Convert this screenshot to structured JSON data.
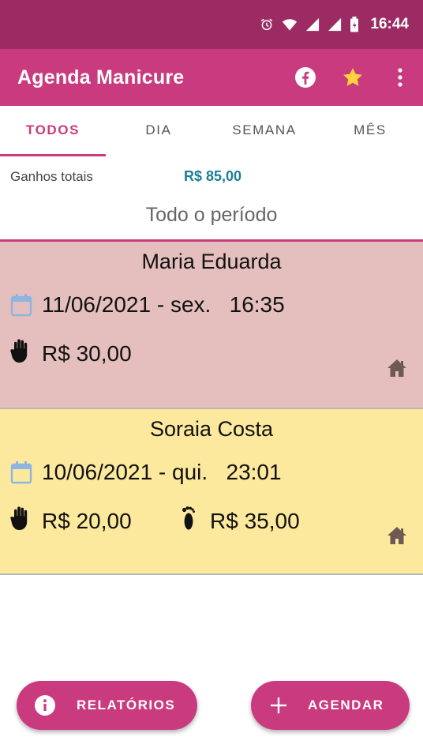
{
  "status_bar": {
    "time": "16:44"
  },
  "app_bar": {
    "title": "Agenda Manicure"
  },
  "tabs": [
    {
      "label": "TODOS",
      "active": true
    },
    {
      "label": "DIA",
      "active": false
    },
    {
      "label": "SEMANA",
      "active": false
    },
    {
      "label": "MÊS",
      "active": false
    }
  ],
  "totals": {
    "label": "Ganhos totais",
    "value": "R$ 85,00"
  },
  "period": "Todo o período",
  "appointments": [
    {
      "name": "Maria Eduarda",
      "date": "11/06/2021 - sex.   16:35",
      "hand_price": "R$ 30,00",
      "foot_price": "",
      "background": "#e4bfbd",
      "location_icon": "home-icon"
    },
    {
      "name": "Soraia Costa",
      "date": "10/06/2021 - qui.   23:01",
      "hand_price": "R$ 20,00",
      "foot_price": "R$ 35,00",
      "background": "#fde99d",
      "location_icon": "home-icon"
    }
  ],
  "buttons": {
    "reports": "RELATÓRIOS",
    "schedule": "AGENDAR"
  },
  "colors": {
    "status_bar": "#9c2a63",
    "primary": "#c93b7e",
    "total_value": "#1d7e96",
    "calendar_icon": "#8fb4e0"
  }
}
